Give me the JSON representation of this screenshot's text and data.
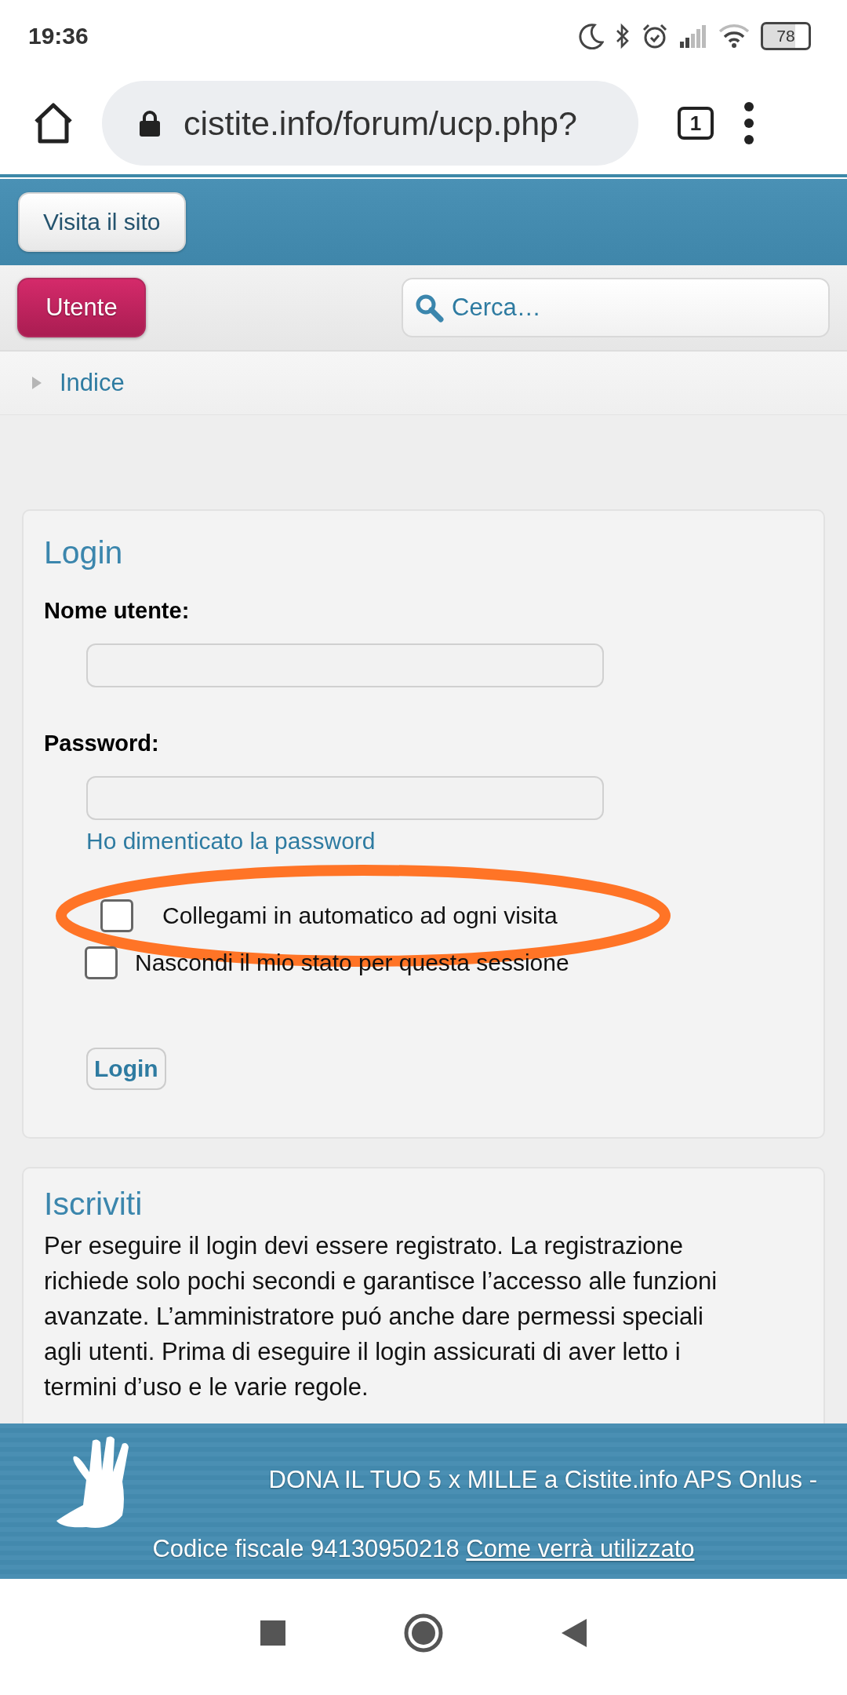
{
  "status_bar": {
    "time": "19:36",
    "battery": "78"
  },
  "browser": {
    "url": "cistite.info/forum/ucp.php?",
    "tab_count": "1"
  },
  "header": {
    "site_button": "Visita il sito",
    "user_button": "Utente",
    "search": {
      "placeholder": "Cerca…"
    }
  },
  "breadcrumb": [
    "Indice"
  ],
  "login": {
    "title": "Login",
    "fields": [
      {
        "label": "Nome utente:"
      },
      {
        "label": "Password:"
      }
    ],
    "forgot_link": "Ho dimenticato la password",
    "options": [
      {
        "label": "Collegami in automatico ad ogni visita",
        "checked": false,
        "highlighted": true
      },
      {
        "label": "Nascondi il mio stato per questa sessione",
        "checked": false,
        "highlighted": false
      }
    ],
    "submit": "Login"
  },
  "register": {
    "title": "Iscriviti",
    "text": "Per eseguire il login devi essere registrato. La registrazione richiede solo pochi secondi e garantisce l’accesso alle funzioni avanzate. L’amministratore puó anche dare permessi speciali agli utenti. Prima di eseguire il login assicurati di aver letto i termini d’uso e le varie regole."
  },
  "banner": {
    "line_1": "DONA IL TUO 5 x MILLE a Cistite.info APS Onlus -",
    "line_2": "Codice fiscale 94130950218",
    "link": "Come verrà utilizzato"
  }
}
